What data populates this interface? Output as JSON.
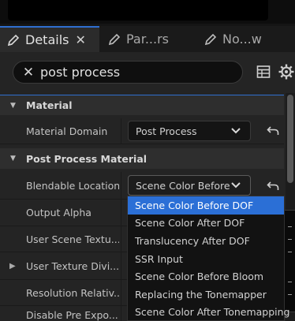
{
  "tabs": [
    {
      "label": "Details",
      "active": true,
      "closable": true,
      "icon": "pencil-icon"
    },
    {
      "label": "Par...rs",
      "active": false,
      "icon": "pencil-icon"
    },
    {
      "label": "No...w",
      "active": false,
      "icon": "pencil-icon"
    }
  ],
  "search": {
    "value": "post process",
    "clear_icon": "close-icon"
  },
  "toolbar": {
    "table_icon": "table-icon",
    "settings_icon": "gear-icon"
  },
  "categories": {
    "material": {
      "label": "Material",
      "expanded": true
    },
    "post_process_material": {
      "label": "Post Process Material",
      "expanded": true
    }
  },
  "properties": {
    "material_domain": {
      "label": "Material Domain",
      "value": "Post Process"
    },
    "blendable_location": {
      "label": "Blendable Location",
      "value": "Scene Color Before DOF",
      "display": "Scene Color Before D"
    },
    "output_alpha": {
      "label": "Output Alpha"
    },
    "user_scene_texture": {
      "label": "User Scene Textu..."
    },
    "user_texture_divisor": {
      "label": "User Texture Divi..."
    },
    "resolution_relative": {
      "label": "Resolution Relativ..."
    },
    "disable_pre_exposure": {
      "label": "Disable Pre Expo..."
    }
  },
  "dropdown": {
    "options": [
      "Scene Color Before DOF",
      "Scene Color After DOF",
      "Translucency After DOF",
      "SSR Input",
      "Scene Color Before Bloom",
      "Replacing the Tonemapper",
      "Scene Color After Tonemapping"
    ],
    "selected_index": 0
  },
  "colors": {
    "accent": "#2f6fd0",
    "selection": "#2b6fd6",
    "panel": "#242424",
    "category": "#2e2e2e"
  }
}
